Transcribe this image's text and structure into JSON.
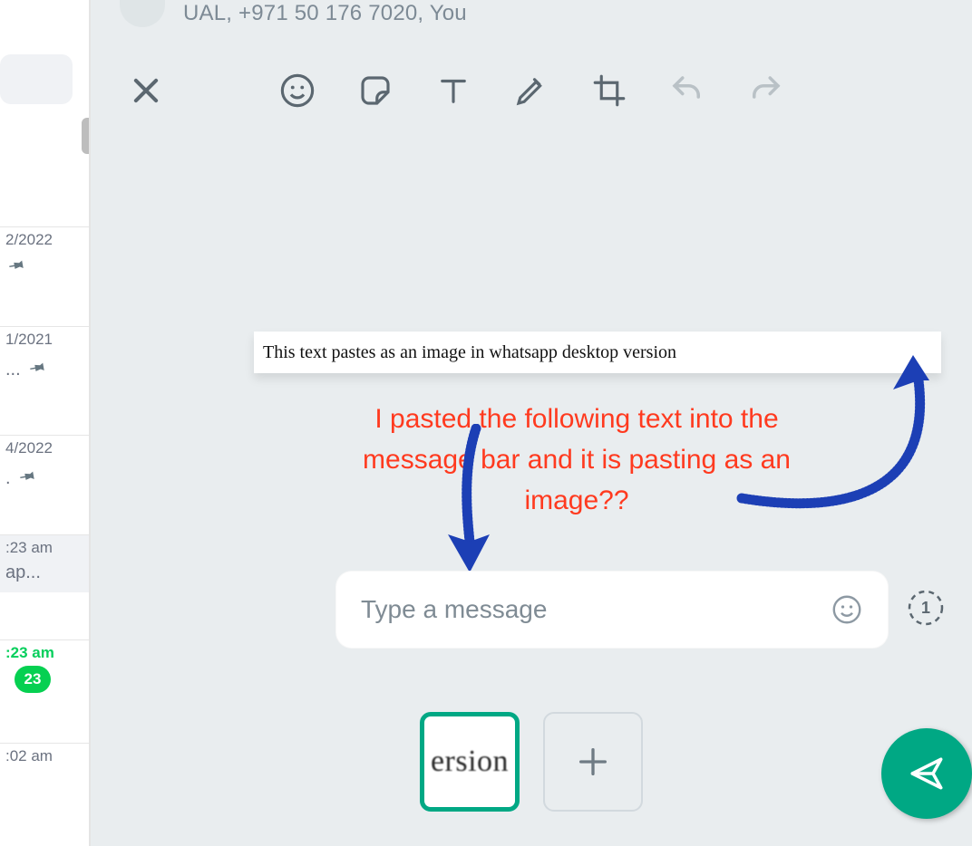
{
  "header": {
    "status_fragment": "UAL, +971 50 176 7020, You"
  },
  "sidebar": {
    "items": [
      {
        "date": "2/2022",
        "sub": ""
      },
      {
        "date": "1/2021",
        "sub": "..."
      },
      {
        "date": "4/2022",
        "sub": "."
      },
      {
        "time": ":23 am",
        "sub": "ap...",
        "active": true
      },
      {
        "time_green": ":23 am",
        "unread": "23"
      },
      {
        "time": ":02 am"
      }
    ]
  },
  "preview_text": "This text pastes as an image in whatsapp desktop version",
  "annotation": "I pasted the following text into the message bar and it is pasting as an image??",
  "caption_placeholder": "Type a message",
  "thumb_preview_fragment": "ersion",
  "colors": {
    "accent": "#00a884",
    "danger": "#ff3a1f",
    "arrow": "#1c3fb5"
  }
}
